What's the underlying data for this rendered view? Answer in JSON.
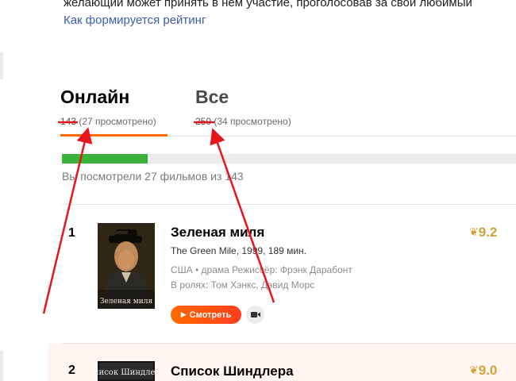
{
  "intro": {
    "line": "желающий может принять в нем участие, проголосовав за свой любимый",
    "link": "Как формируется рейтинг"
  },
  "tabs": [
    {
      "label": "Онлайн",
      "count": "143",
      "watched": "(27 просмотрено)",
      "active": true
    },
    {
      "label": "Все",
      "count": "250",
      "watched": "(34 просмотрено)",
      "active": false
    }
  ],
  "progress": {
    "watched": 27,
    "total": 143,
    "text": "Вы посмотрели 27 фильмов из 143"
  },
  "movies": [
    {
      "rank": "1",
      "title": "Зеленая миля",
      "subtitle": "The Green Mile, 1999, 189 мин.",
      "meta": "США • драма  Режиссёр: Фрэнк Дарабонт",
      "cast": "В ролях: Том Хэнкс, Дэвид Морс",
      "rating": "9.2",
      "poster_caption": "Зеленая миля",
      "watch_label": "Смотреть"
    },
    {
      "rank": "2",
      "title": "Список Шиндлера",
      "rating": "9.0",
      "poster_caption": "Список Шиндлера"
    }
  ],
  "colors": {
    "accent": "#ff6a00",
    "progress": "#3bb33b",
    "rating": "#d1a23a",
    "annotation": "#e8141b",
    "link": "#3b5cad"
  },
  "icons": {
    "play": "play-icon",
    "trailer": "video-camera-icon",
    "wreath": "laurel-wreath-icon"
  }
}
